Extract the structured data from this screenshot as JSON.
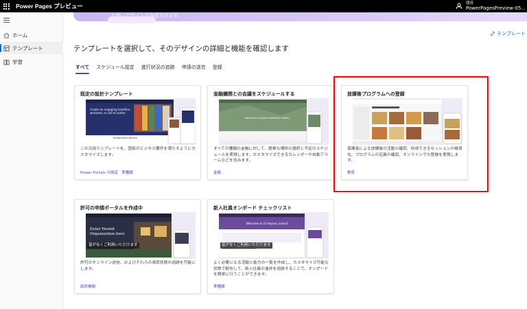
{
  "app": {
    "title": "Power Pages プレビュー"
  },
  "environment": {
    "label": "環境",
    "name": "PowerPagesPreview-05..."
  },
  "sidebar": {
    "items": [
      {
        "label": "ホーム",
        "icon": "home-icon"
      },
      {
        "label": "テンプレート",
        "icon": "template-icon",
        "active": true
      },
      {
        "label": "学習",
        "icon": "book-icon"
      }
    ]
  },
  "banner": {
    "text": "を使ってサイトを作成できます。"
  },
  "header": {
    "template_link": "テンプレート",
    "title": "テンプレートを選択して、そのデザインの詳細と機能を確認します"
  },
  "tabs": [
    {
      "label": "すべて",
      "active": true
    },
    {
      "label": "スケジュール設定"
    },
    {
      "label": "進行状況の追跡"
    },
    {
      "label": "申請の送信"
    },
    {
      "label": "登録"
    }
  ],
  "cards": [
    {
      "title": "既定の設計テンプレート",
      "description": "この汎用テンプレートを、固有のビジネス要件を満たすようにカスタマイズします。",
      "tags": [
        "Power Portals の既定",
        "実種類"
      ],
      "preview_text": "Create an engaging headline, welcome, or call to action",
      "preview_sub": "Introduction section"
    },
    {
      "title": "金融機関との会議をスケジュールする",
      "description": "すべての種類の金融に対して、簡単な場所の選択と予定のスケジュールを実現します。カスタマイズできるカレンダーや自動アラームなどを含みます。",
      "tags": [
        "金融"
      ],
      "preview_text": "Welcome to [Insert Institution Name]"
    },
    {
      "title": "放課後プログラムへの登録",
      "description": "保護者による放課後の活動の確認、利用できるセッションの概見化、プログラムの定員の確認、オンラインでの登録を実現します。",
      "tags": [
        "教育"
      ]
    },
    {
      "title": "許可の申請ポータルを作成中",
      "description": "許可のオンライン送信、およびそれらの承認状態の追跡を可能にします。",
      "tags": [
        "政府機関"
      ],
      "preview_text": "Enter Permit Organization here",
      "preview_note": "皆がなくご利用いただけます"
    },
    {
      "title": "新入社員オンボード チェックリスト",
      "description": "よく必要になる活動と能力の一覧を作成し、カスタマイズ可能な状態で配布して、新入社員の進捗を追跡することで、オンボードを簡単に行うことができます。",
      "tags": [
        "実種類"
      ],
      "preview_text": "Welcome to [Company name]!",
      "preview_note": "皆がなくご利用いただけます"
    }
  ],
  "colors": {
    "accent": "#5b3fb8",
    "highlight": "#e00000",
    "link": "#0f6cbd"
  }
}
